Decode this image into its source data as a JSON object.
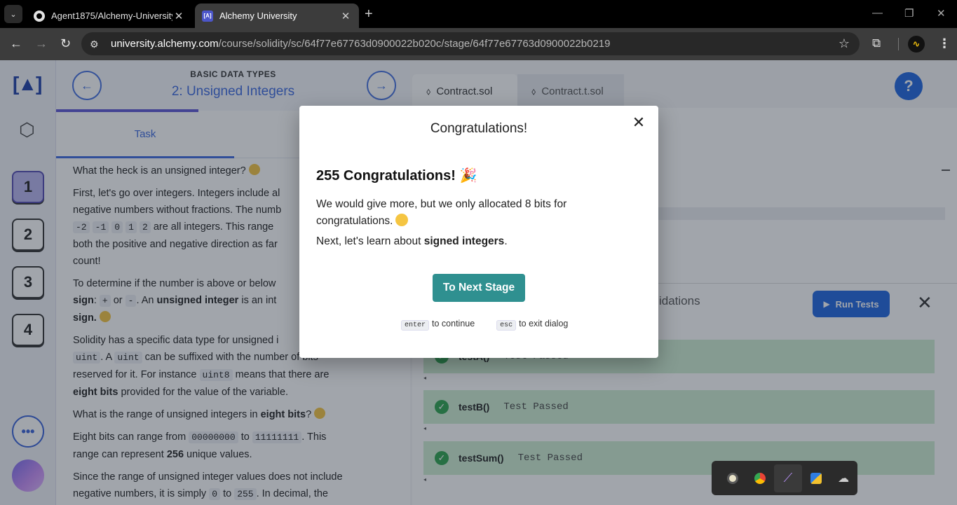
{
  "browser": {
    "tabs": [
      {
        "title": "Agent1875/Alchemy-University",
        "active": false
      },
      {
        "title": "Alchemy University",
        "active": true
      }
    ],
    "url_host": "university.alchemy.com",
    "url_path": "/course/solidity/sc/64f77e67763d0900022b020c/stage/64f77e67763d0900022b0219",
    "new_tab": "+",
    "close": "✕"
  },
  "app": {
    "logo": "[▲]",
    "stages": [
      "1",
      "2",
      "3",
      "4"
    ],
    "more": "•••",
    "lesson_section": "BASIC DATA TYPES",
    "lesson_title": "2: Unsigned Integers",
    "task_tab": "Task",
    "lesson_text": {
      "p1": "What the heck is an unsigned integer?",
      "p2a": "First, let's go over integers. Integers include al",
      "p2b": "negative numbers without fractions. The numb",
      "p2c": "are all integers. This range",
      "p2d": "both the positive and negative direction as far",
      "p2e": "count!",
      "p3a": "To determine if the number is above or below",
      "p3b": "sign",
      "p3c": "or",
      "p3d": ". An",
      "p3e": "unsigned integer",
      "p3f": "is an int",
      "p3g": "sign.",
      "p4a": "Solidity has a specific data type for unsigned i",
      "p4b": ". A",
      "p4c": "can be suffixed with the number of bits",
      "p4d": "reserved for it. For instance",
      "p4e": "means that there are",
      "p4f": "eight bits",
      "p4g": "provided for the value of the variable.",
      "p5a": "What is the range of unsigned integers in",
      "p5b": "eight bits",
      "p5c": "?",
      "p6a": "Eight bits can range from",
      "p6b": "to",
      "p6c": ". This",
      "p6d": "range can represent",
      "p6e": "256",
      "p6f": "unique values.",
      "p7a": "Since the range of unsigned integer values does not include",
      "p7b": "negative numbers, it is simply",
      "p7c": "to",
      "p7d": ". In decimal, the",
      "codes": {
        "neg2": "-2",
        "neg1": "-1",
        "zero": "0",
        "one": "1",
        "two": "2",
        "plus": "+",
        "minus": "-",
        "uint1": "uint",
        "uint2": "uint",
        "uint8": "uint8",
        "b0": "00000000",
        "b1": "11111111",
        "r0": "0",
        "r255": "255"
      }
    },
    "file_tabs": [
      "Contract.sol",
      "Contract.t.sol"
    ],
    "help": "?",
    "tests_title": "idations",
    "run_tests": "Run Tests",
    "tests": [
      {
        "name": "testA()",
        "status": "Test Passed"
      },
      {
        "name": "testB()",
        "status": "Test Passed"
      },
      {
        "name": "testSum()",
        "status": "Test Passed"
      }
    ]
  },
  "modal": {
    "title": "Congratulations!",
    "heading": "255 Congratulations!",
    "heading_emoji": "🎉",
    "para1": "We would give more, but we only allocated 8 bits for congratulations.",
    "para2_prefix": "Next, let's learn about",
    "para2_bold": "signed integers",
    "para2_suffix": ".",
    "button": "To Next Stage",
    "hint_enter_key": "enter",
    "hint_enter_text": "to continue",
    "hint_esc_key": "esc",
    "hint_esc_text": "to exit dialog",
    "close": "✕"
  },
  "tray": {
    "items": [
      "drive-icon",
      "chrome-icon",
      "pen-icon",
      "shield-warning-icon",
      "cloud-off-icon"
    ]
  }
}
